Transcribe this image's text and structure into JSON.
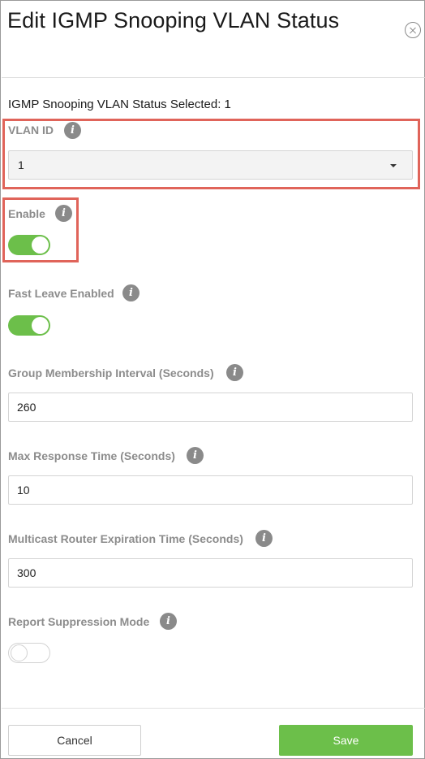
{
  "dialog": {
    "title": "Edit IGMP Snooping VLAN Status",
    "selected_text": "IGMP Snooping VLAN Status Selected: 1",
    "info_glyph": "i",
    "close_icon": "close-icon"
  },
  "fields": {
    "vlan_id": {
      "label": "VLAN ID",
      "value": "1"
    },
    "enable": {
      "label": "Enable",
      "on": true
    },
    "fast_leave": {
      "label": "Fast Leave Enabled",
      "on": true
    },
    "group_membership_interval": {
      "label": "Group Membership Interval (Seconds)",
      "value": "260"
    },
    "max_response_time": {
      "label": "Max Response Time (Seconds)",
      "value": "10"
    },
    "mrouter_expiration": {
      "label": "Multicast Router Expiration Time (Seconds)",
      "value": "300"
    },
    "report_suppression": {
      "label": "Report Suppression Mode",
      "on": false
    }
  },
  "buttons": {
    "cancel": "Cancel",
    "save": "Save"
  },
  "colors": {
    "accent": "#6cbf4a",
    "highlight": "#e0645a",
    "label": "#8c8c8c"
  }
}
